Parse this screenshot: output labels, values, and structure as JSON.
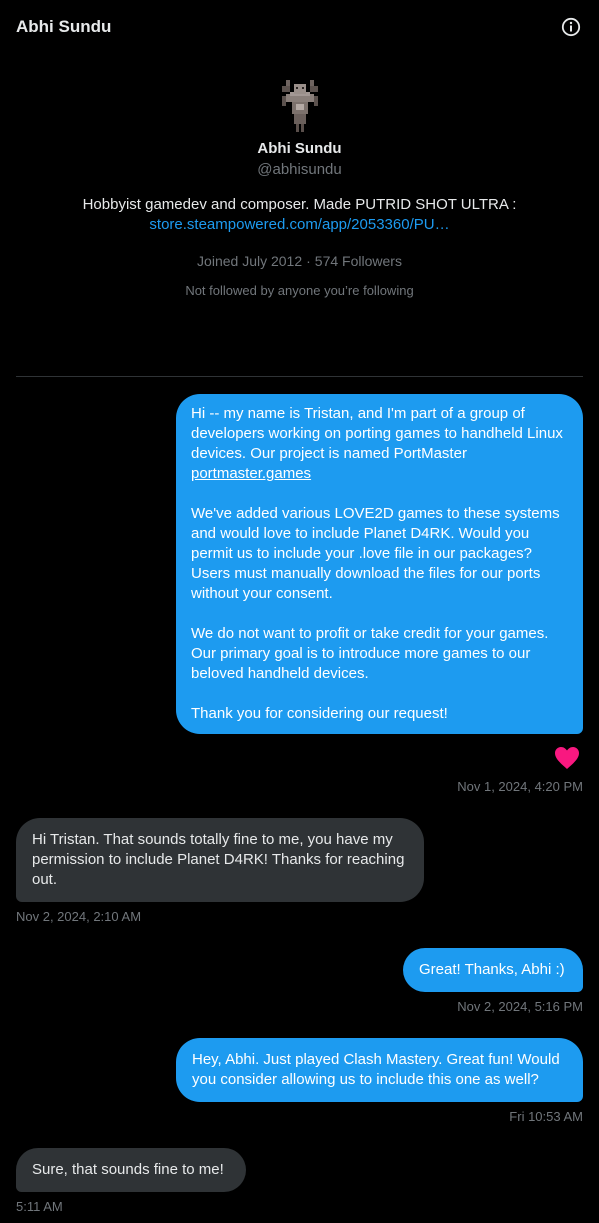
{
  "header": {
    "title": "Abhi Sundu",
    "info_icon": "info-icon"
  },
  "profile": {
    "avatar_icon": "pixel-art-avatar",
    "name": "Abhi Sundu",
    "handle": "@abhisundu",
    "bio": "Hobbyist gamedev and composer. Made PUTRID SHOT ULTRA :",
    "bio_link": "store.steampowered.com/app/2053360/PU…",
    "joined": "Joined July 2012",
    "followers": "574 Followers",
    "followed_by": "Not followed by anyone you’re following"
  },
  "messages": [
    {
      "side": "sent",
      "paragraph1": "Hi -- my name is Tristan, and I'm part of a group of developers working on porting games to handheld Linux devices. Our project is named PortMaster ",
      "link": "portmaster.games",
      "paragraph2": "\n\nWe've added various LOVE2D games to these systems and would love to include Planet D4RK. Would you permit us to include your .love file in our packages? Users must manually download the files for our ports without your consent.\n\nWe do not want to profit or take credit for your games. Our primary goal is to introduce more games to our beloved handheld devices.\n\nThank you for considering our request!",
      "reaction": "heart",
      "timestamp": "Nov 1, 2024, 4:20 PM"
    },
    {
      "side": "recv",
      "text": "Hi Tristan. That sounds totally fine to me, you have my permission to include Planet D4RK! Thanks for reaching out.",
      "timestamp": "Nov 2, 2024, 2:10 AM"
    },
    {
      "side": "sent",
      "text": "Great! Thanks, Abhi :)",
      "timestamp": "Nov 2, 2024, 5:16 PM"
    },
    {
      "side": "sent",
      "text": "Hey, Abhi. Just played Clash Mastery. Great fun! Would you consider allowing us to include this one as well?",
      "timestamp": "Fri 10:53 AM"
    },
    {
      "side": "recv",
      "text": "Sure, that sounds fine to me!",
      "timestamp": "5:11 AM"
    }
  ],
  "colors": {
    "sent_bubble": "#1d9bf0",
    "recv_bubble": "#2f3336",
    "heart": "#f91880",
    "muted": "#71767b"
  }
}
